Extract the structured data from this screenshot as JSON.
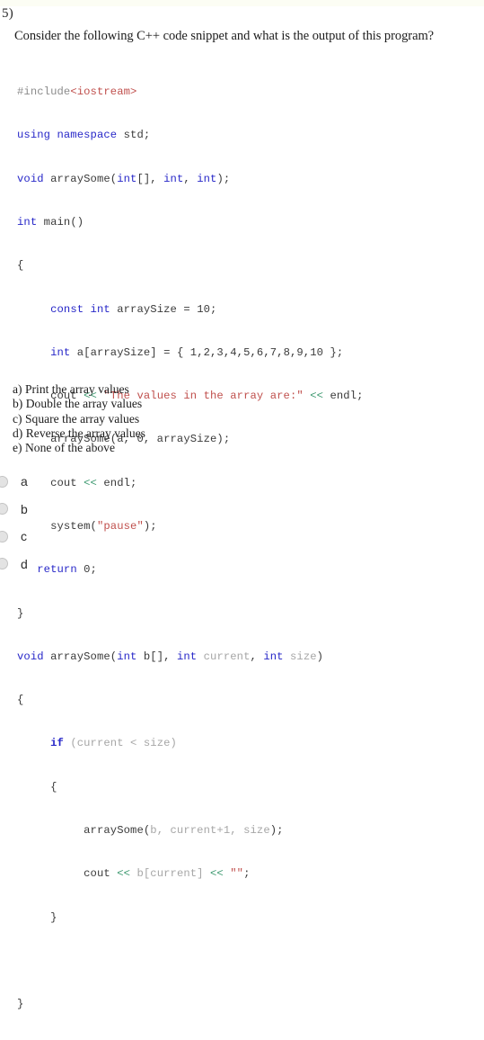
{
  "question": {
    "number": "5)",
    "prompt": "Consider the following C++ code snippet and what is the output of this program?"
  },
  "code": {
    "language": "C++",
    "lines": [
      "#include<iostream>",
      "using namespace std;",
      "void arraySome(int[], int, int);",
      "int main()",
      "{",
      "     const int arraySize = 10;",
      "     int a[arraySize] = { 1,2,3,4,5,6,7,8,9,10 };",
      "     cout << \"The values in the array are:\" << endl;",
      "     arraySome(a, 0, arraySize);",
      "     cout << endl;",
      "     system(\"pause\");",
      "   return 0;",
      "}",
      "void arraySome(int b[], int current, int size)",
      "{",
      "     if (current < size)",
      "     {",
      "          arraySome(b, current+1, size);",
      "          cout << b[current] << \"\";",
      "     }",
      "",
      "}"
    ]
  },
  "answers": {
    "options": [
      "a) Print the array values",
      "b) Double the array values",
      "c) Square the array values",
      "d) Reverse the array values",
      "e) None of the above"
    ]
  },
  "choices": [
    {
      "id": "a",
      "label": "a",
      "selected": false
    },
    {
      "id": "b",
      "label": "b",
      "selected": false
    },
    {
      "id": "c",
      "label": "c",
      "selected": false
    },
    {
      "id": "d",
      "label": "d",
      "selected": false
    }
  ],
  "colors": {
    "keyword": "#2727c8",
    "string": "#c0504d",
    "operator": "#3d9970",
    "identifier": "#3a3a3a",
    "dim_identifier": "#a6a6a6",
    "preprocessor": "#8c8c8c",
    "text": "#1c1c1c",
    "background": "#ffffff"
  }
}
